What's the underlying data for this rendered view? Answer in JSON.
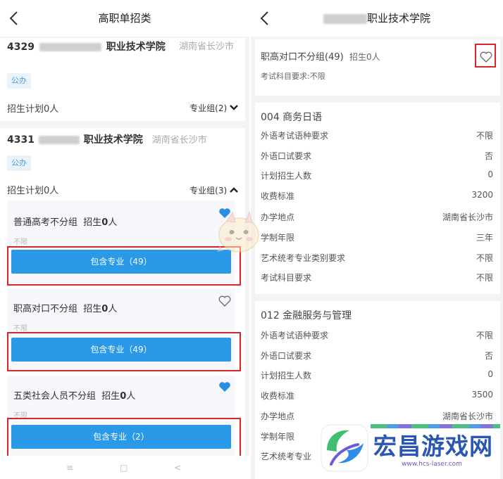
{
  "left": {
    "title": "高职单招类",
    "schools": [
      {
        "code": "4329",
        "name": "职业技术学院",
        "location": "湖南省长沙市",
        "badge": "公办",
        "plan": "招生计划0人",
        "groups": "专业组(2)"
      },
      {
        "code": "4331",
        "name": "职业技术学院",
        "location": "湖南省长沙市",
        "badge": "公办",
        "plan": "招生计划0人",
        "groups": "专业组(3)",
        "group_list": [
          {
            "name": "普通高考不分组",
            "enroll_prefix": "招生",
            "enroll_count": "0",
            "enroll_suffix": "人",
            "subject": "不限",
            "button": "包含专业（49）",
            "favorited": true
          },
          {
            "name": "职高对口不分组",
            "enroll_prefix": "招生",
            "enroll_count": "0",
            "enroll_suffix": "人",
            "subject": "不限",
            "button": "包含专业（49）",
            "favorited": false
          },
          {
            "name": "五类社会人员不分组",
            "enroll_prefix": "招生",
            "enroll_count": "0",
            "enroll_suffix": "人",
            "subject": "不限",
            "button": "包含专业（2）",
            "favorited": true
          }
        ]
      }
    ],
    "nav": [
      "≡",
      "□",
      "<"
    ]
  },
  "right": {
    "title": "职业技术学院",
    "group": {
      "name": "职高对口不分组(49)",
      "enroll": "招生0人",
      "subject": "考试科目要求:不限",
      "favorited": false
    },
    "majors": [
      {
        "title": "004 商务日语",
        "rows": [
          {
            "k": "外语考试语种要求",
            "v": "不限"
          },
          {
            "k": "外语口试要求",
            "v": "否"
          },
          {
            "k": "计划招生人数",
            "v": "0"
          },
          {
            "k": "收费标准",
            "v": "3200"
          },
          {
            "k": "办学地点",
            "v": "湖南省长沙市"
          },
          {
            "k": "学制年限",
            "v": "三年"
          },
          {
            "k": "艺术统考专业类别要求",
            "v": "不限"
          },
          {
            "k": "考试科目要求",
            "v": "不限"
          }
        ]
      },
      {
        "title": "012 金融服务与管理",
        "rows": [
          {
            "k": "外语考试语种要求",
            "v": "不限"
          },
          {
            "k": "外语口试要求",
            "v": "否"
          },
          {
            "k": "计划招生人数",
            "v": "0"
          },
          {
            "k": "收费标准",
            "v": "3500"
          },
          {
            "k": "办学地点",
            "v": "湖南省长沙市"
          },
          {
            "k": "学制年限",
            "v": ""
          },
          {
            "k": "艺术统考专业",
            "v": ""
          }
        ]
      }
    ]
  },
  "watermark": {
    "text": "宏昌游戏网",
    "url": "www.hcs-laser.com"
  },
  "colors": {
    "accent": "#2a9ae8",
    "highlight": "#d7262a",
    "badge_text": "#4a9ed8"
  }
}
